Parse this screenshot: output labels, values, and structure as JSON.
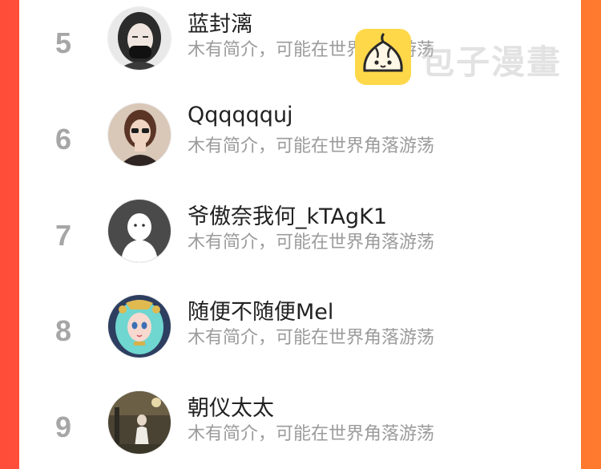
{
  "rankings": [
    {
      "rank": "5",
      "name": "蓝封漓",
      "bio": "木有简介，可能在世界角落游荡"
    },
    {
      "rank": "6",
      "name": "Qqqqqquj",
      "bio": "木有简介，可能在世界角落游荡"
    },
    {
      "rank": "7",
      "name": "爷傲奈我何_kTAgK1",
      "bio": "木有简介，可能在世界角落游荡"
    },
    {
      "rank": "8",
      "name": "随便不随便Mel",
      "bio": "木有简介，可能在世界角落游荡"
    },
    {
      "rank": "9",
      "name": "朝仪太太",
      "bio": "木有简介，可能在世界角落游荡"
    }
  ],
  "watermark": {
    "text": "包子漫畫",
    "icon": "bun-logo-icon"
  },
  "colors": {
    "accent": "#ff5a35",
    "rank": "#a6a6a6",
    "bio": "#9b9b9b",
    "logo": "#ffd84a"
  }
}
